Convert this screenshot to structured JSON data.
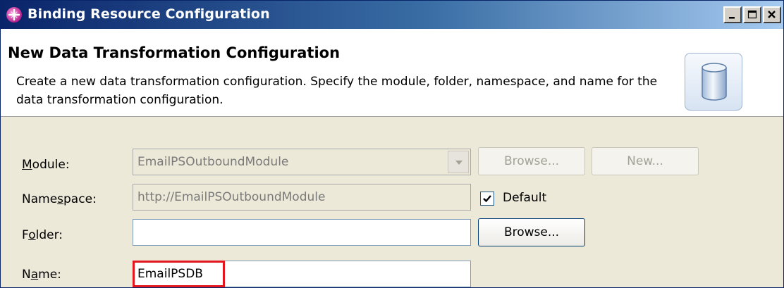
{
  "window": {
    "title": "Binding Resource Configuration",
    "app_icon": "wizard-icon",
    "controls": {
      "minimize": "minimize-icon",
      "maximize": "maximize-icon",
      "close": "close-icon"
    }
  },
  "banner": {
    "title": "New Data Transformation Configuration",
    "description": "Create a new data transformation configuration.  Specify the module, folder, namespace, and name for the data transformation configuration.",
    "icon": "data-cylinder-icon"
  },
  "form": {
    "module": {
      "label_prefix": "",
      "label_access": "M",
      "label_suffix": "odule:",
      "value": "EmailPSOutboundModule",
      "browse_label": "Browse...",
      "new_label": "New..."
    },
    "namespace": {
      "label_prefix": "Name",
      "label_access": "s",
      "label_suffix": "pace:",
      "value": "http://EmailPSOutboundModule",
      "default_checked": true,
      "default_access": "D",
      "default_suffix": "efault"
    },
    "folder": {
      "label_prefix": "F",
      "label_access": "o",
      "label_suffix": "lder:",
      "value": "",
      "browse_label": "Browse..."
    },
    "name": {
      "label_prefix": "N",
      "label_access": "a",
      "label_suffix": "me:",
      "value": "EmailPSDB"
    }
  },
  "colors": {
    "highlight": "#e3161f",
    "titlebar_start": "#0a246a",
    "titlebar_end": "#a6caf0"
  }
}
